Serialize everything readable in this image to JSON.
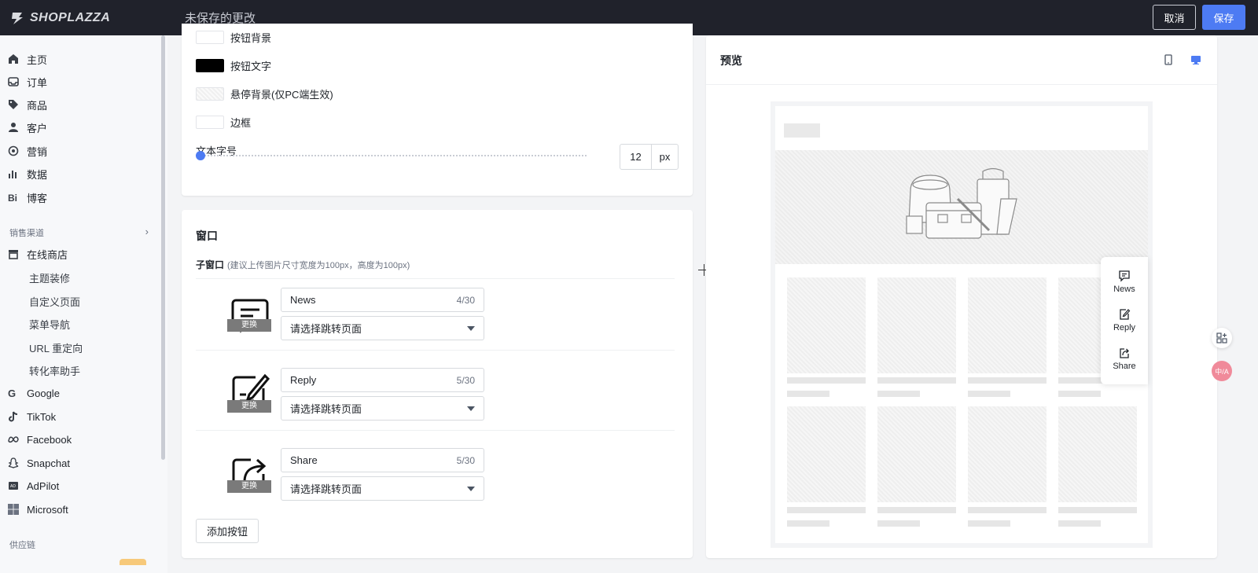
{
  "topbar": {
    "brand": "SHOPLAZZA",
    "unsaved_text": "未保存的更改",
    "cancel_label": "取消",
    "save_label": "保存",
    "accent": "#4d7bf3"
  },
  "sidebar": {
    "main_items": [
      {
        "label": "主页",
        "icon": "home-icon"
      },
      {
        "label": "订单",
        "icon": "inbox-icon"
      },
      {
        "label": "商品",
        "icon": "tag-icon"
      },
      {
        "label": "客户",
        "icon": "user-icon"
      },
      {
        "label": "营销",
        "icon": "target-icon"
      },
      {
        "label": "数据",
        "icon": "bar-chart-icon"
      },
      {
        "label": "博客",
        "icon": "blog-icon"
      }
    ],
    "sales_channel_heading": "销售渠道",
    "online_store": "在线商店",
    "online_store_sub": [
      "主题装修",
      "自定义页面",
      "菜单导航",
      "URL 重定向",
      "转化率助手"
    ],
    "channels": [
      "Google",
      "TikTok",
      "Facebook",
      "Snapchat",
      "AdPilot",
      "Microsoft"
    ],
    "supply_chain_heading": "供应链"
  },
  "settings": {
    "swatches": [
      {
        "label": "按钮背景"
      },
      {
        "label": "按钮文字"
      },
      {
        "label": "悬停背景(仅PC端生效)"
      },
      {
        "label": "边框"
      }
    ],
    "font_size_label": "文本字号",
    "font_size_value": "12",
    "font_size_unit": "px",
    "font_size_level": 0.0
  },
  "window_section": {
    "title": "窗口",
    "sub_title": "子窗口",
    "hint": "(建议上传图片尺寸宽度为100px，高度为100px)",
    "replace_label": "更换",
    "entries": [
      {
        "name": "News",
        "count": "4/30",
        "select_placeholder": "请选择跳转页面",
        "icon": "message-icon"
      },
      {
        "name": "Reply",
        "count": "5/30",
        "select_placeholder": "请选择跳转页面",
        "icon": "edit-icon"
      },
      {
        "name": "Share",
        "count": "5/30",
        "select_placeholder": "请选择跳转页面",
        "icon": "share-icon"
      }
    ],
    "add_button": "添加按钮"
  },
  "preview": {
    "title": "预览",
    "float_items": [
      "News",
      "Reply",
      "Share"
    ]
  },
  "floating_badge": "中/A"
}
